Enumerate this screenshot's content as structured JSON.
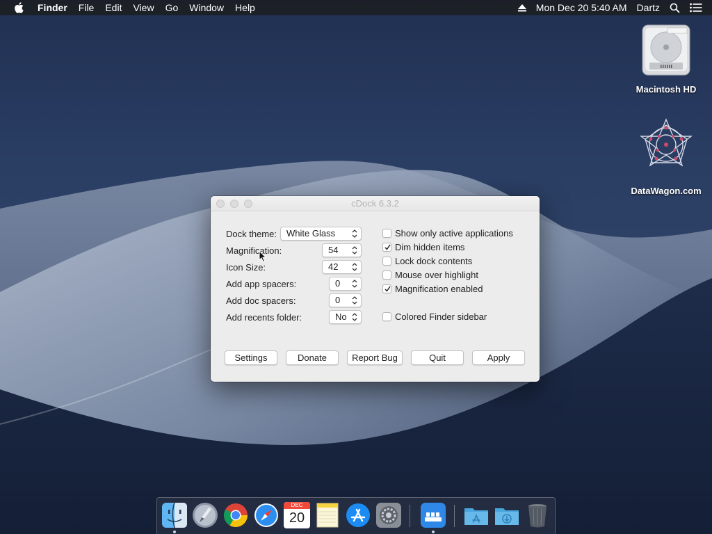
{
  "menubar": {
    "app_name": "Finder",
    "menus": [
      "File",
      "Edit",
      "View",
      "Go",
      "Window",
      "Help"
    ],
    "datetime": "Mon Dec 20  5:40 AM",
    "user": "Dartz"
  },
  "desktop_icons": [
    {
      "label": "Macintosh HD",
      "icon": "hard-drive-icon"
    },
    {
      "label": "DataWagon.com",
      "icon": "datawagon-logo-icon"
    }
  ],
  "window": {
    "title": "cDock 6.3.2",
    "settings": {
      "dock_theme": {
        "label": "Dock theme:",
        "value": "White Glass"
      },
      "magnification": {
        "label": "Magnification:",
        "value": "54"
      },
      "icon_size": {
        "label": "Icon Size:",
        "value": "42"
      },
      "app_spacers": {
        "label": "Add app spacers:",
        "value": "0"
      },
      "doc_spacers": {
        "label": "Add doc spacers:",
        "value": "0"
      },
      "recents_folder": {
        "label": "Add recents folder:",
        "value": "No"
      }
    },
    "checkboxes": [
      {
        "label": "Show only active applications",
        "checked": false
      },
      {
        "label": "Dim hidden items",
        "checked": true
      },
      {
        "label": "Lock dock contents",
        "checked": false
      },
      {
        "label": "Mouse over highlight",
        "checked": false
      },
      {
        "label": "Magnification enabled",
        "checked": true
      },
      {
        "label": "Colored Finder sidebar",
        "checked": false
      }
    ],
    "buttons": {
      "settings": "Settings",
      "donate": "Donate",
      "report_bug": "Report Bug",
      "quit": "Quit",
      "apply": "Apply"
    }
  },
  "dock": {
    "calendar_month": "DEC",
    "calendar_day": "20",
    "items": [
      "finder-icon",
      "launchpad-icon",
      "chrome-icon",
      "safari-icon",
      "calendar-icon",
      "notes-icon",
      "app-store-icon",
      "system-preferences-icon",
      "cdock-icon",
      "applications-folder-icon",
      "downloads-folder-icon",
      "trash-icon"
    ]
  },
  "colors": {
    "menubar": "#1c1e24",
    "window_bg": "#ececec",
    "dock_bg": "#283042"
  }
}
